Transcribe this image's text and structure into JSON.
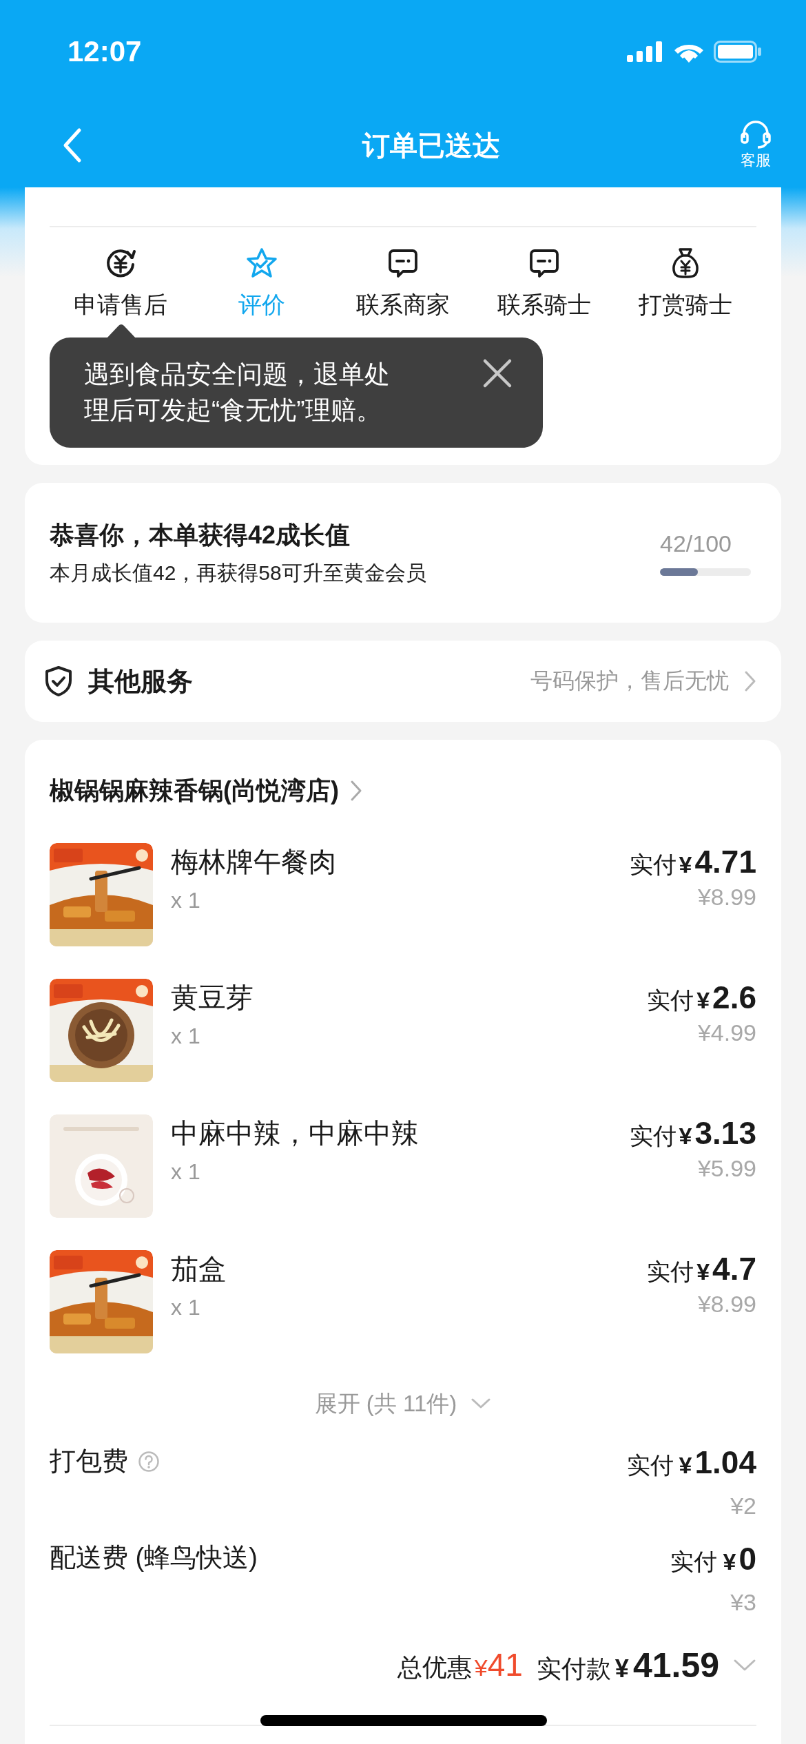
{
  "status_bar": {
    "time": "12:07"
  },
  "nav": {
    "title": "订单已送达",
    "service_label": "客服"
  },
  "actions": [
    {
      "label": "申请售后",
      "kind": "refund",
      "selected": false
    },
    {
      "label": "评价",
      "kind": "review",
      "selected": true
    },
    {
      "label": "联系商家",
      "kind": "chat",
      "selected": false
    },
    {
      "label": "联系骑士",
      "kind": "chat",
      "selected": false
    },
    {
      "label": "打赏骑士",
      "kind": "tip",
      "selected": false
    }
  ],
  "tooltip": {
    "lines": [
      "遇到食品安全问题，退单处",
      "理后可发起“食无忧”理赔。"
    ]
  },
  "growth": {
    "title": "恭喜你，本单获得42成长值",
    "subtitle": "本月成长值42，再获得58可升至黄金会员",
    "reading": "42/100",
    "level": 0.42
  },
  "services": {
    "title": "其他服务",
    "hint": "号码保护，售后无忧"
  },
  "store": {
    "name": "椒锅锅麻辣香锅(尚悦湾店)"
  },
  "items": [
    {
      "name": "梅林牌午餐肉",
      "qty": "x 1",
      "paid_label": "实付",
      "currency": "¥",
      "amount": "4.71",
      "original": "¥8.99",
      "kind": "picture"
    },
    {
      "name": "黄豆芽",
      "qty": "x 1",
      "paid_label": "实付",
      "currency": "¥",
      "amount": "2.6",
      "original": "¥4.99",
      "kind": "picture"
    },
    {
      "name": "中麻中辣，中麻中辣",
      "qty": "x 1",
      "paid_label": "实付",
      "currency": "¥",
      "amount": "3.13",
      "original": "¥5.99",
      "kind": "picture"
    },
    {
      "name": "茄盒",
      "qty": "x 1",
      "paid_label": "实付",
      "currency": "¥",
      "amount": "4.7",
      "original": "¥8.99",
      "kind": "picture"
    }
  ],
  "expand": {
    "label": "展开 (共 11件)"
  },
  "fees": [
    {
      "label": "打包费",
      "help": true,
      "paid_label": "实付",
      "currency": "¥",
      "amount": "1.04",
      "original": "¥2"
    },
    {
      "label": "配送费 (蜂鸟快送)",
      "help": false,
      "paid_label": "实付",
      "currency": "¥",
      "amount": "0",
      "original": "¥3"
    }
  ],
  "total": {
    "discount_label": "总优惠",
    "discount_currency": "¥",
    "discount": "41",
    "paid_label": "实付款",
    "currency": "¥",
    "amount": "41.59"
  }
}
